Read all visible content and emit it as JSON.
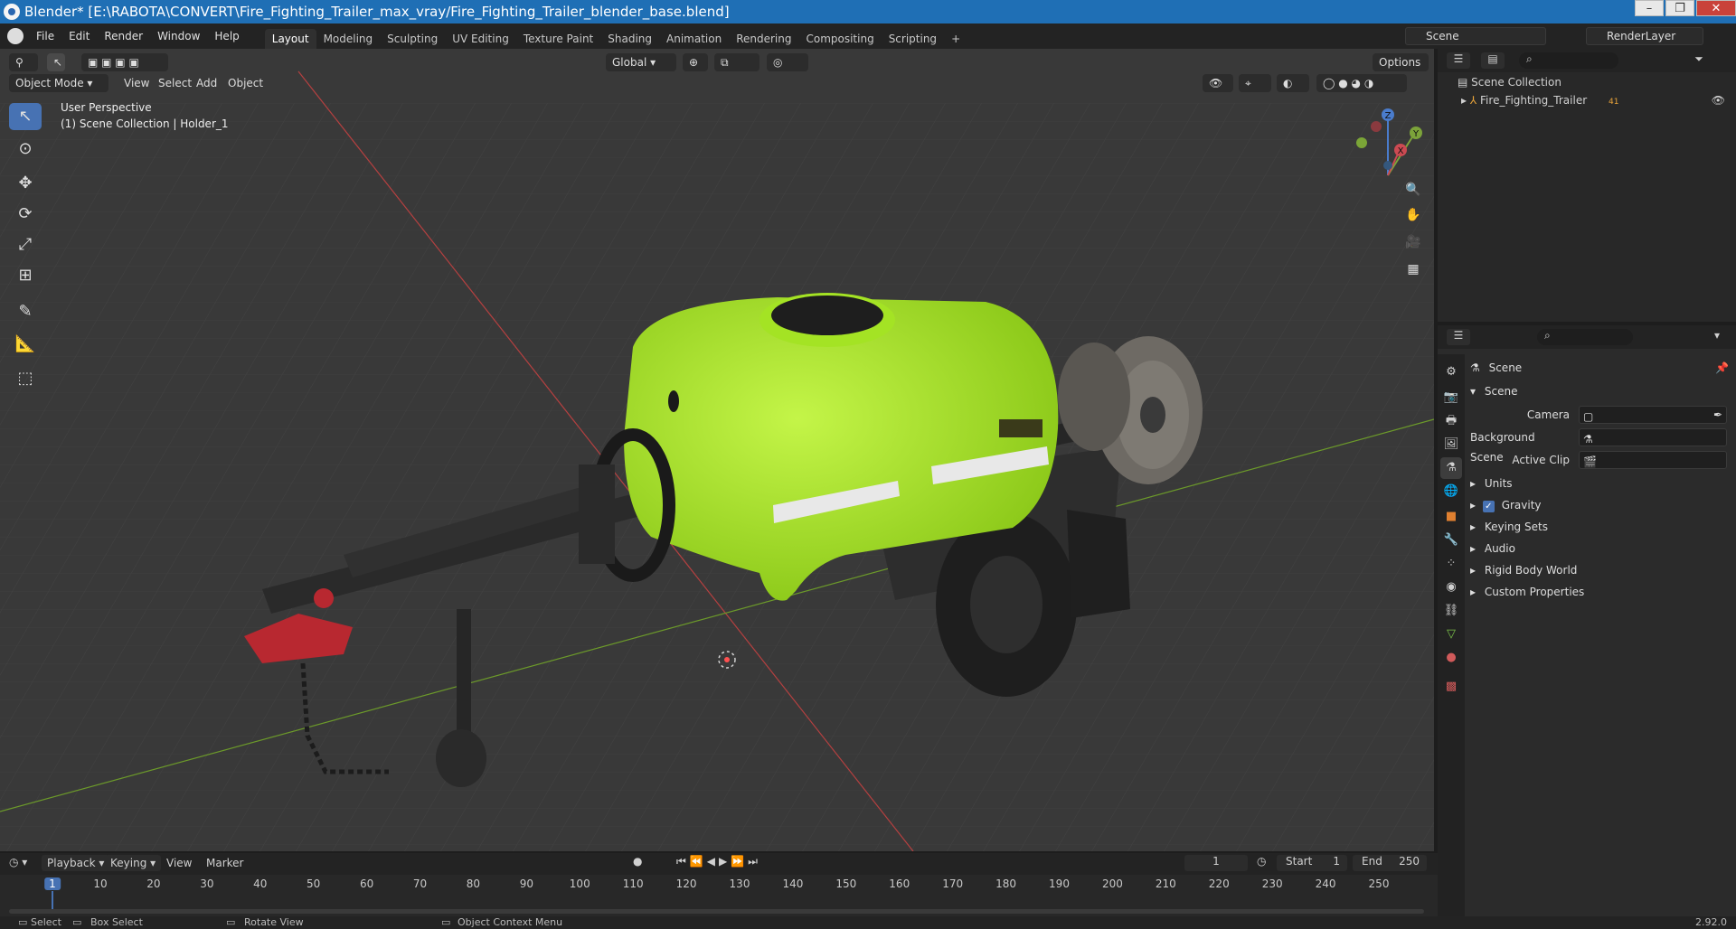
{
  "window": {
    "title": "Blender* [E:\\RABOTA\\CONVERT\\Fire_Fighting_Trailer_max_vray/Fire_Fighting_Trailer_blender_base.blend]"
  },
  "menu": [
    "File",
    "Edit",
    "Render",
    "Window",
    "Help"
  ],
  "workspaces": [
    "Layout",
    "Modeling",
    "Sculpting",
    "UV Editing",
    "Texture Paint",
    "Shading",
    "Animation",
    "Rendering",
    "Compositing",
    "Scripting"
  ],
  "workspace_add": "+",
  "scene_name": "Scene",
  "render_layer": "RenderLayer",
  "viewport": {
    "mode": "Object Mode",
    "menus": [
      "View",
      "Select",
      "Add",
      "Object"
    ],
    "transform_orientation": "Global",
    "options_label": "Options",
    "overlay_title": "User Perspective",
    "overlay_subtitle": "(1) Scene Collection | Holder_1",
    "gizmo_axes": {
      "z": "Z",
      "y": "Y",
      "x": "X"
    }
  },
  "outliner": {
    "root": "Scene Collection",
    "items": [
      {
        "label": "Fire_Fighting_Trailer",
        "badge": "41"
      }
    ]
  },
  "properties": {
    "header": "Scene",
    "panel_title": "Scene",
    "fields": [
      {
        "label": "Camera",
        "value": ""
      },
      {
        "label": "Background Scene",
        "value": ""
      },
      {
        "label": "Active Clip",
        "value": ""
      }
    ],
    "sections": [
      {
        "label": "Units",
        "checkbox": false
      },
      {
        "label": "Gravity",
        "checkbox": true
      },
      {
        "label": "Keying Sets",
        "checkbox": false
      },
      {
        "label": "Audio",
        "checkbox": false
      },
      {
        "label": "Rigid Body World",
        "checkbox": false
      },
      {
        "label": "Custom Properties",
        "checkbox": false
      }
    ]
  },
  "timeline": {
    "menus": [
      "Playback",
      "Keying",
      "View",
      "Marker"
    ],
    "current_frame": "1",
    "start_label": "Start",
    "start_value": "1",
    "end_label": "End",
    "end_value": "250",
    "ticks": [
      "1",
      "10",
      "20",
      "30",
      "40",
      "50",
      "60",
      "70",
      "80",
      "90",
      "100",
      "110",
      "120",
      "130",
      "140",
      "150",
      "160",
      "170",
      "180",
      "190",
      "200",
      "210",
      "220",
      "230",
      "240",
      "250"
    ]
  },
  "statusbar": {
    "items": [
      "Select",
      "Box Select",
      "Rotate View",
      "Object Context Menu"
    ],
    "version": "2.92.0"
  },
  "colors": {
    "tank": "#a9ea22",
    "accent": "#4772b3"
  }
}
